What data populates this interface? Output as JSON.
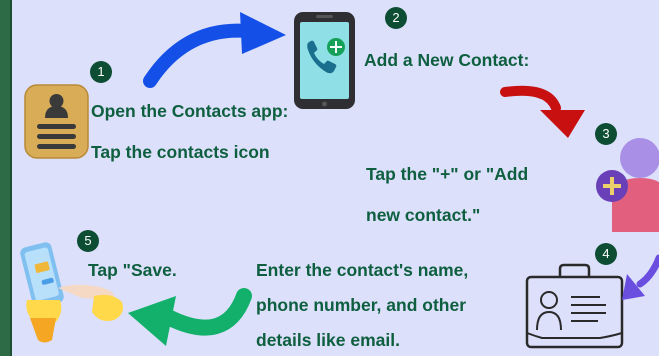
{
  "steps": [
    {
      "number": "1",
      "lines": [
        "Open the Contacts app:",
        "Tap the contacts icon"
      ]
    },
    {
      "number": "2",
      "lines": [
        "Add a New Contact:"
      ]
    },
    {
      "number": "3",
      "lines": [
        "Tap the \"+\" or \"Add",
        "new contact.\""
      ]
    },
    {
      "number": "4",
      "lines": [
        "Enter the contact's name,",
        "phone number, and other",
        "details like email."
      ]
    },
    {
      "number": "5",
      "lines": [
        "Tap \"Save."
      ]
    }
  ],
  "icons": {
    "step1": "contacts-app-icon",
    "step2": "phone-add-icon",
    "step3": "add-person-icon",
    "step4": "contact-card-icon",
    "step5": "phone-tap-icon"
  },
  "colors": {
    "background": "#dce0fb",
    "text": "#0e5f3f",
    "badge": "#0d4d33",
    "arrow_blue": "#1450e8",
    "arrow_red": "#c81010",
    "arrow_purple": "#6a4ee0",
    "arrow_green": "#12b06a"
  }
}
